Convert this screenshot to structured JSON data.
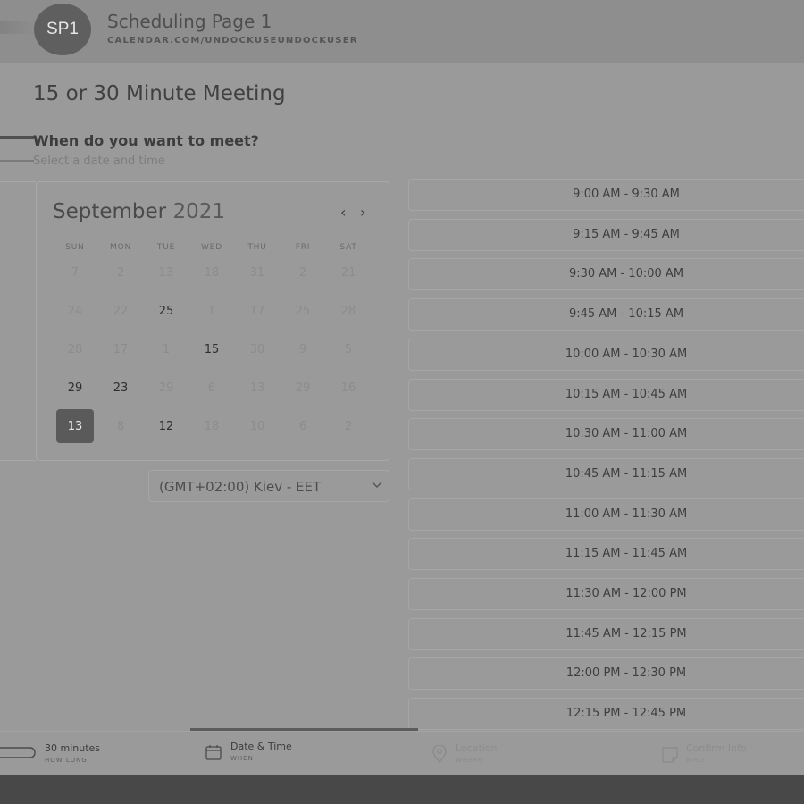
{
  "header": {
    "avatar_text": "SP1",
    "page_name": "Scheduling Page 1",
    "page_url": "CALENDAR.COM/UNDOCKUSEUNDOCKUSER"
  },
  "meeting": {
    "title": "15 or 30 Minute Meeting",
    "question": "When do you want to meet?",
    "subtitle": "Select a date and time"
  },
  "calendar": {
    "month": "September",
    "year": "2021",
    "prev_icon": "chevron-left-icon",
    "next_icon": "chevron-right-icon",
    "weekdays": [
      "SUN",
      "MON",
      "TUE",
      "WED",
      "THU",
      "FRI",
      "SAT"
    ],
    "weeks": [
      [
        {
          "d": "7",
          "s": "off"
        },
        {
          "d": "2",
          "s": "off"
        },
        {
          "d": "13",
          "s": "off"
        },
        {
          "d": "18",
          "s": "off"
        },
        {
          "d": "31",
          "s": "off"
        },
        {
          "d": "2",
          "s": "off"
        },
        {
          "d": "21",
          "s": "off"
        }
      ],
      [
        {
          "d": "24",
          "s": "off"
        },
        {
          "d": "22",
          "s": "off"
        },
        {
          "d": "25",
          "s": "on"
        },
        {
          "d": "1",
          "s": "off"
        },
        {
          "d": "17",
          "s": "off"
        },
        {
          "d": "25",
          "s": "off"
        },
        {
          "d": "28",
          "s": "off"
        }
      ],
      [
        {
          "d": "28",
          "s": "off"
        },
        {
          "d": "17",
          "s": "off"
        },
        {
          "d": "1",
          "s": "off"
        },
        {
          "d": "15",
          "s": "on"
        },
        {
          "d": "30",
          "s": "off"
        },
        {
          "d": "9",
          "s": "off"
        },
        {
          "d": "5",
          "s": "off"
        }
      ],
      [
        {
          "d": "29",
          "s": "on"
        },
        {
          "d": "23",
          "s": "on"
        },
        {
          "d": "29",
          "s": "off"
        },
        {
          "d": "6",
          "s": "off"
        },
        {
          "d": "13",
          "s": "off"
        },
        {
          "d": "29",
          "s": "off"
        },
        {
          "d": "16",
          "s": "off"
        }
      ],
      [
        {
          "d": "13",
          "s": "sel"
        },
        {
          "d": "8",
          "s": "off"
        },
        {
          "d": "12",
          "s": "on"
        },
        {
          "d": "18",
          "s": "off"
        },
        {
          "d": "10",
          "s": "off"
        },
        {
          "d": "6",
          "s": "off"
        },
        {
          "d": "2",
          "s": "off"
        }
      ]
    ]
  },
  "timezone": {
    "label": "(GMT+02:00) Kiev - EET",
    "icon": "chevron-down-icon"
  },
  "slots": [
    "9:00 AM - 9:30 AM",
    "9:15 AM - 9:45 AM",
    "9:30 AM - 10:00 AM",
    "9:45 AM - 10:15 AM",
    "10:00 AM - 10:30 AM",
    "10:15 AM - 10:45 AM",
    "10:30 AM - 11:00 AM",
    "10:45 AM - 11:15 AM",
    "11:00 AM - 11:30 AM",
    "11:15 AM - 11:45 AM",
    "11:30 AM - 12:00 PM",
    "11:45 AM - 12:15 PM",
    "12:00 PM - 12:30 PM",
    "12:15 PM - 12:45 PM"
  ],
  "steps": [
    {
      "label": "30 minutes",
      "caption": "HOW LONG",
      "icon": "duration-icon"
    },
    {
      "label": "Date & Time",
      "caption": "WHEN",
      "icon": "calendar-icon"
    },
    {
      "label": "Location",
      "caption": "WHERE",
      "icon": "location-pin-icon"
    },
    {
      "label": "Confirm Info",
      "caption": "WHO",
      "icon": "note-icon"
    }
  ]
}
